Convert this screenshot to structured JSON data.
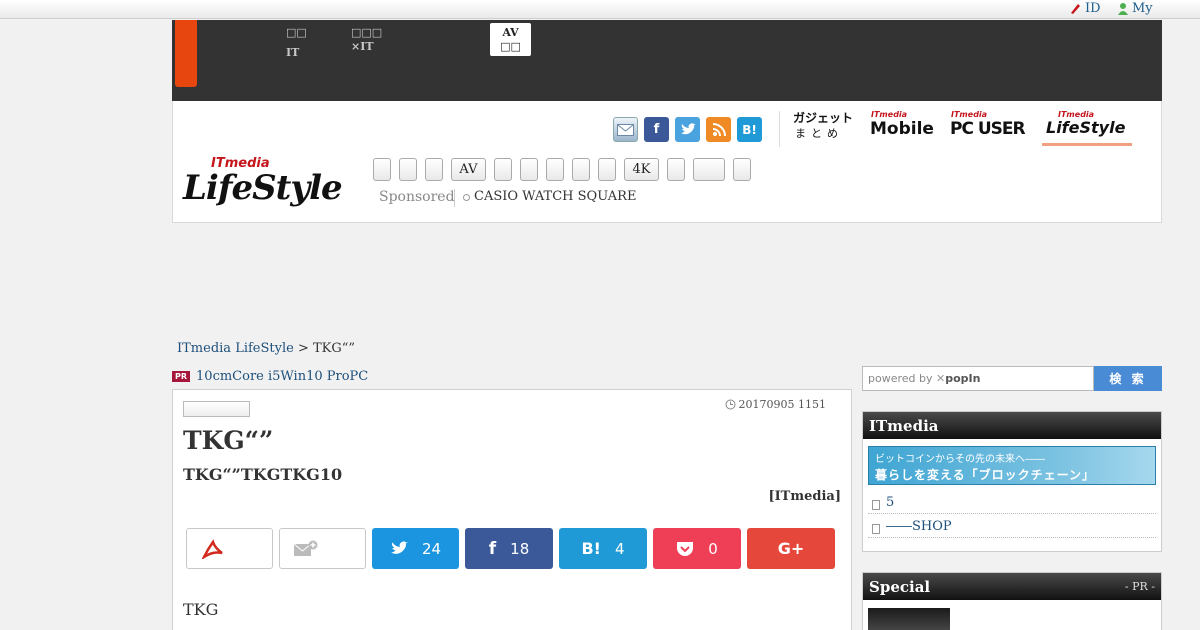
{
  "topbar": {
    "id_label": "ID",
    "my_label": "My"
  },
  "nav": {
    "item1": {
      "line1": "□□",
      "line2": "IT"
    },
    "item2": {
      "line1": "□□□",
      "line2": "×IT"
    },
    "active": {
      "line1": "AV",
      "line2": "□□"
    }
  },
  "share_icons": [
    "mail-icon",
    "facebook-icon",
    "twitter-icon",
    "rss-icon",
    "hatena-icon"
  ],
  "share_labels": {
    "hatena": "B!"
  },
  "site_logos": {
    "gadget": {
      "big": "ガジェット",
      "small": "まとめ"
    },
    "mobile": {
      "small": "ITmedia",
      "big": "Mobile"
    },
    "pcuser": {
      "small": "ITmedia",
      "big": "PC USER"
    },
    "lifestyle_small": {
      "small": "ITmedia",
      "big": "LifeStyle"
    }
  },
  "brand_logo": {
    "small": "ITmedia",
    "big": "LifeStyle"
  },
  "tags": [
    "",
    "",
    "",
    "AV",
    "",
    "",
    "",
    "",
    "",
    "4K",
    "",
    "",
    ""
  ],
  "sponsored": {
    "label": "Sponsored",
    "link": "CASIO WATCH SQUARE"
  },
  "breadcrumb": {
    "home": "ITmedia LifeStyle",
    "sep": " > ",
    "current": "TKG“”"
  },
  "pr": {
    "badge": "PR",
    "text": "10cmCore i5Win10 ProPC"
  },
  "article": {
    "date": "20170905 1151",
    "title": "TKG“”",
    "subtitle": "TKG“”TKGTKG10",
    "source": "[ITmedia]",
    "body": "TKG"
  },
  "actions": {
    "twitter_count": "24",
    "facebook_count": "18",
    "hatena_label": "B!",
    "hatena_count": "4",
    "pocket_count": "0",
    "gplus_label": "G+"
  },
  "colors": {
    "twitter": "#1b95e0",
    "facebook": "#3b5998",
    "hatena": "#1f9ad6",
    "pocket": "#ef3f56",
    "gplus": "#e5483a",
    "accent": "#e8460f"
  },
  "search": {
    "placeholder_prefix": "powered by ",
    "placeholder_brand": "popIn",
    "button": "検 索"
  },
  "sidebar": {
    "itmedia": {
      "title": "ITmedia",
      "banner_line1": "ビットコインからその先の未来へ――",
      "banner_line2": "暮らしを変える「ブロックチェーン」",
      "links": [
        "5",
        "――SHOP"
      ]
    },
    "special": {
      "title": "Special",
      "pr": "- PR -"
    }
  }
}
